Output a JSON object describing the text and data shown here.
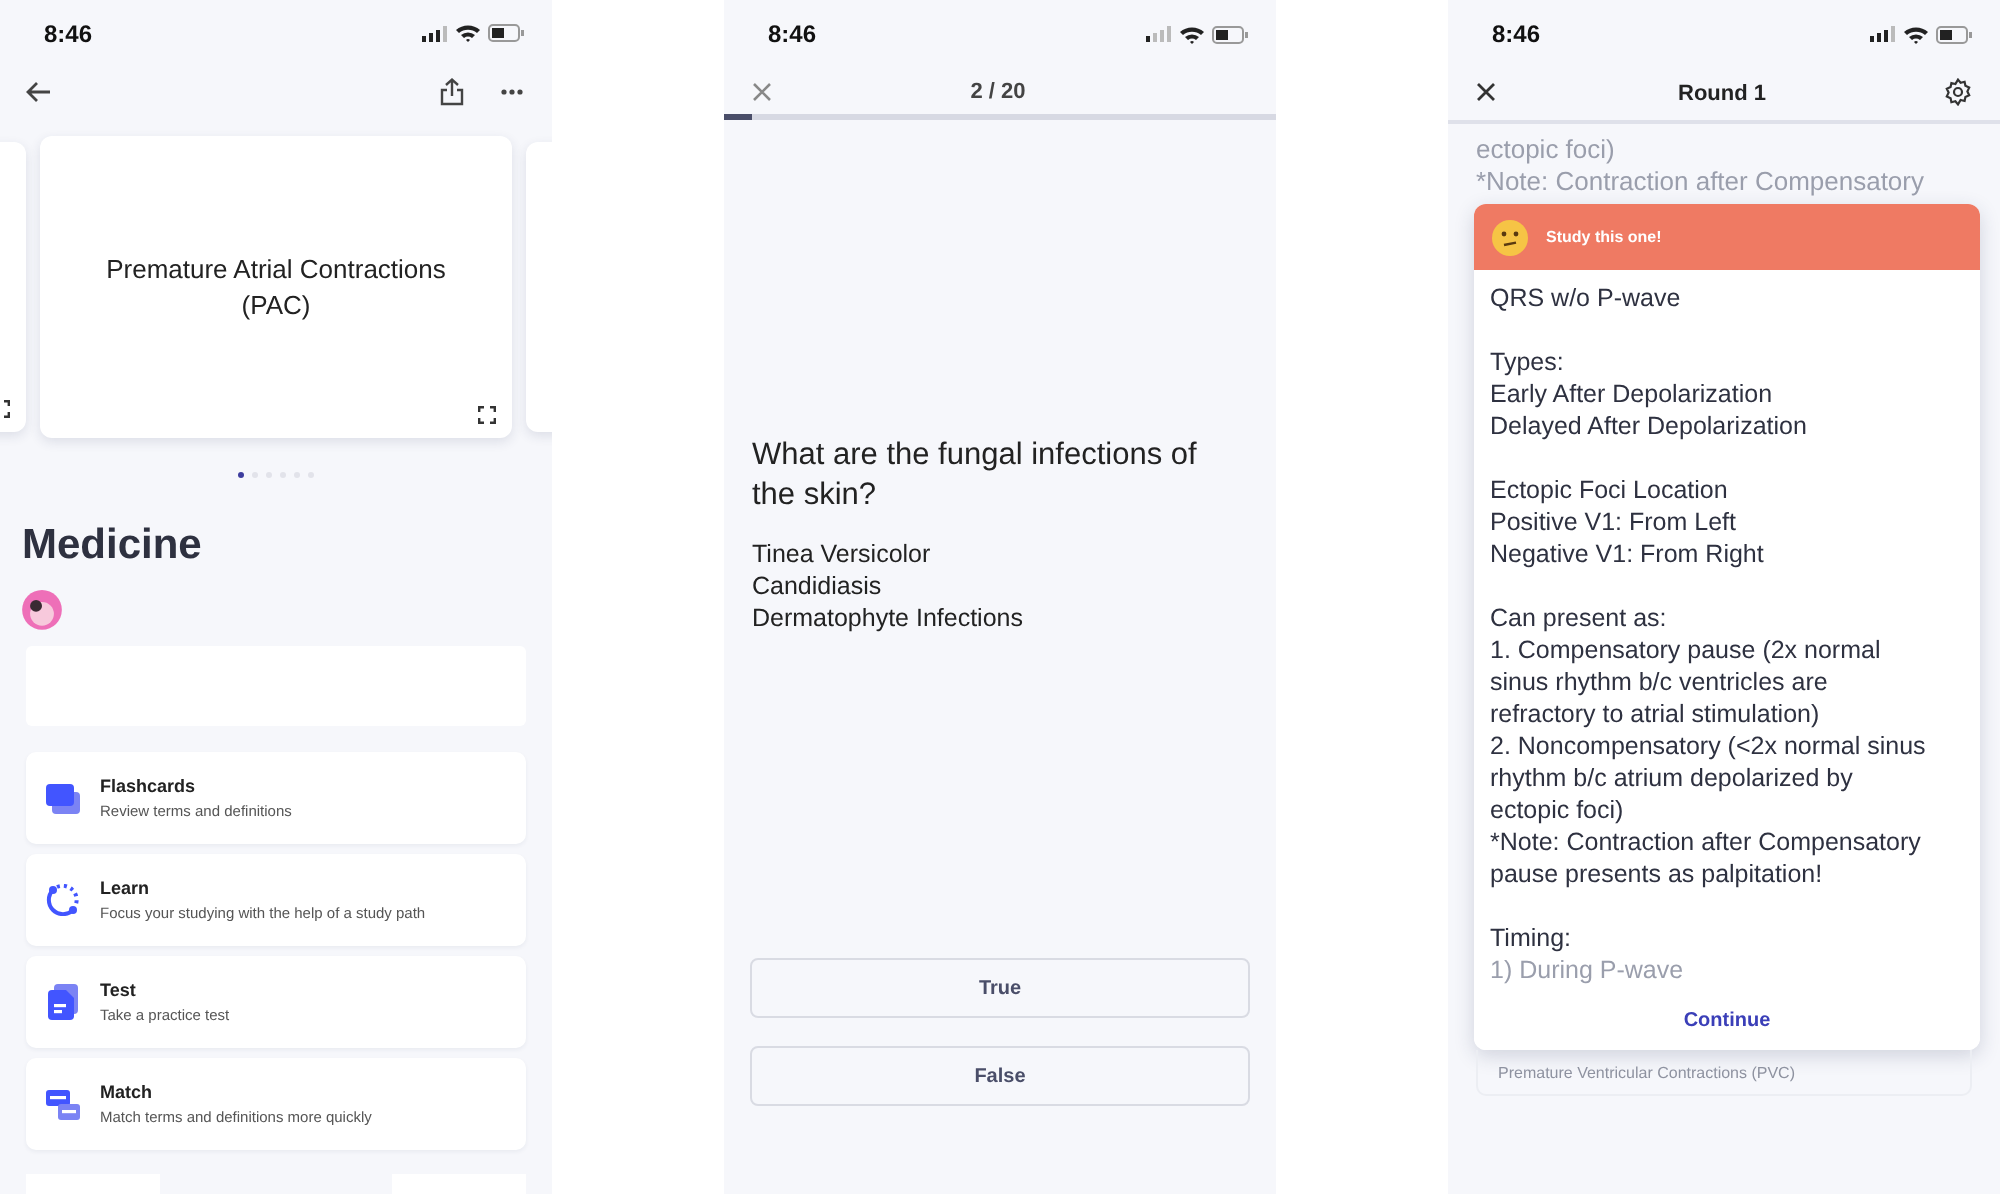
{
  "set_screen": {
    "status_bar": {
      "time": "8:46"
    },
    "cards": [
      {
        "kind": "partial"
      },
      {
        "kind": "main",
        "term": "Premature Atrial Contractions (PAC)"
      },
      {
        "kind": "partial"
      }
    ],
    "carousel_dots": [
      {
        "selected": true
      },
      {
        "selected": false
      },
      {
        "selected": false
      },
      {
        "selected": false
      },
      {
        "selected": false
      },
      {
        "selected": false
      }
    ],
    "title": "Medicine",
    "study_modes": [
      {
        "kind": "flashcards",
        "title": "Flashcards",
        "subtitle": "Review terms and definitions"
      },
      {
        "kind": "learn",
        "title": "Learn",
        "subtitle": "Focus your studying with the help of a study path"
      },
      {
        "kind": "test",
        "title": "Test",
        "subtitle": "Take a practice test"
      },
      {
        "kind": "match",
        "title": "Match",
        "subtitle": "Match terms and definitions more quickly"
      }
    ]
  },
  "test_screen": {
    "status_bar": {
      "time": "8:46"
    },
    "counter": "2 / 20",
    "progress": {
      "level": 0.05
    },
    "question": "What are the fungal infections of the skin?",
    "answer_lines": [
      "Tinea Versicolor",
      "Candidiasis",
      "Dermatophyte Infections"
    ],
    "choices": [
      {
        "label": "True"
      },
      {
        "label": "False"
      }
    ]
  },
  "learn_screen": {
    "status_bar": {
      "time": "8:46"
    },
    "title": "Round 1",
    "background_lines": [
      "ectopic foci)",
      "*Note: Contraction after Compensatory"
    ],
    "feedback": {
      "banner": "Study this one!",
      "paragraphs": [
        [
          "QRS w/o P-wave"
        ],
        [
          "Types:",
          "Early After Depolarization",
          "Delayed After Depolarization"
        ],
        [
          "Ectopic Foci Location",
          "Positive V1: From Left",
          "Negative V1: From Right"
        ],
        [
          "Can present as:",
          "1. Compensatory pause (2x normal sinus rhythm b/c ventricles are refractory to atrial stimulation)",
          "2. Noncompensatory (<2x normal sinus rhythm b/c atrium depolarized by ectopic foci)",
          "*Note: Contraction after Compensatory pause presents as palpitation!"
        ],
        [
          "Timing:"
        ]
      ],
      "faded_line": "1) During P-wave",
      "button": "Continue"
    },
    "next_term": "Premature Ventricular Contractions (PVC)"
  }
}
